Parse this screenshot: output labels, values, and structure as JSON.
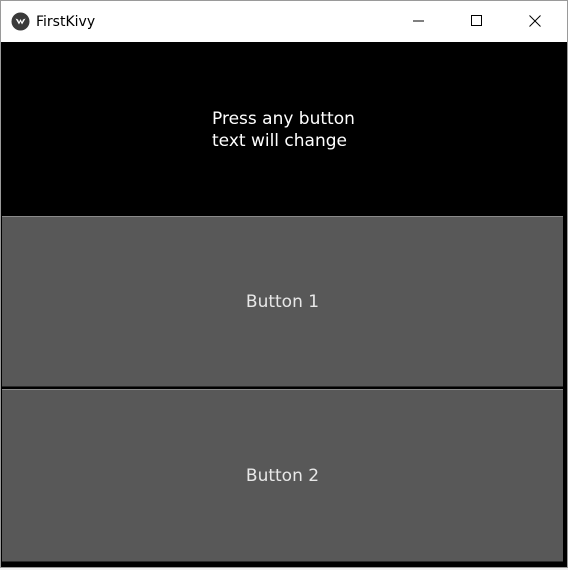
{
  "window": {
    "title": "FirstKivy",
    "controls": {
      "minimize_icon": "minimize-icon",
      "maximize_icon": "maximize-icon",
      "close_icon": "close-icon"
    }
  },
  "label": {
    "text": "Press any button\ntext will change"
  },
  "buttons": [
    {
      "label": "Button 1"
    },
    {
      "label": "Button 2"
    }
  ],
  "colors": {
    "background": "#000000",
    "button_background": "#585858",
    "button_text": "#e8e8e8",
    "label_text": "#ffffff"
  }
}
